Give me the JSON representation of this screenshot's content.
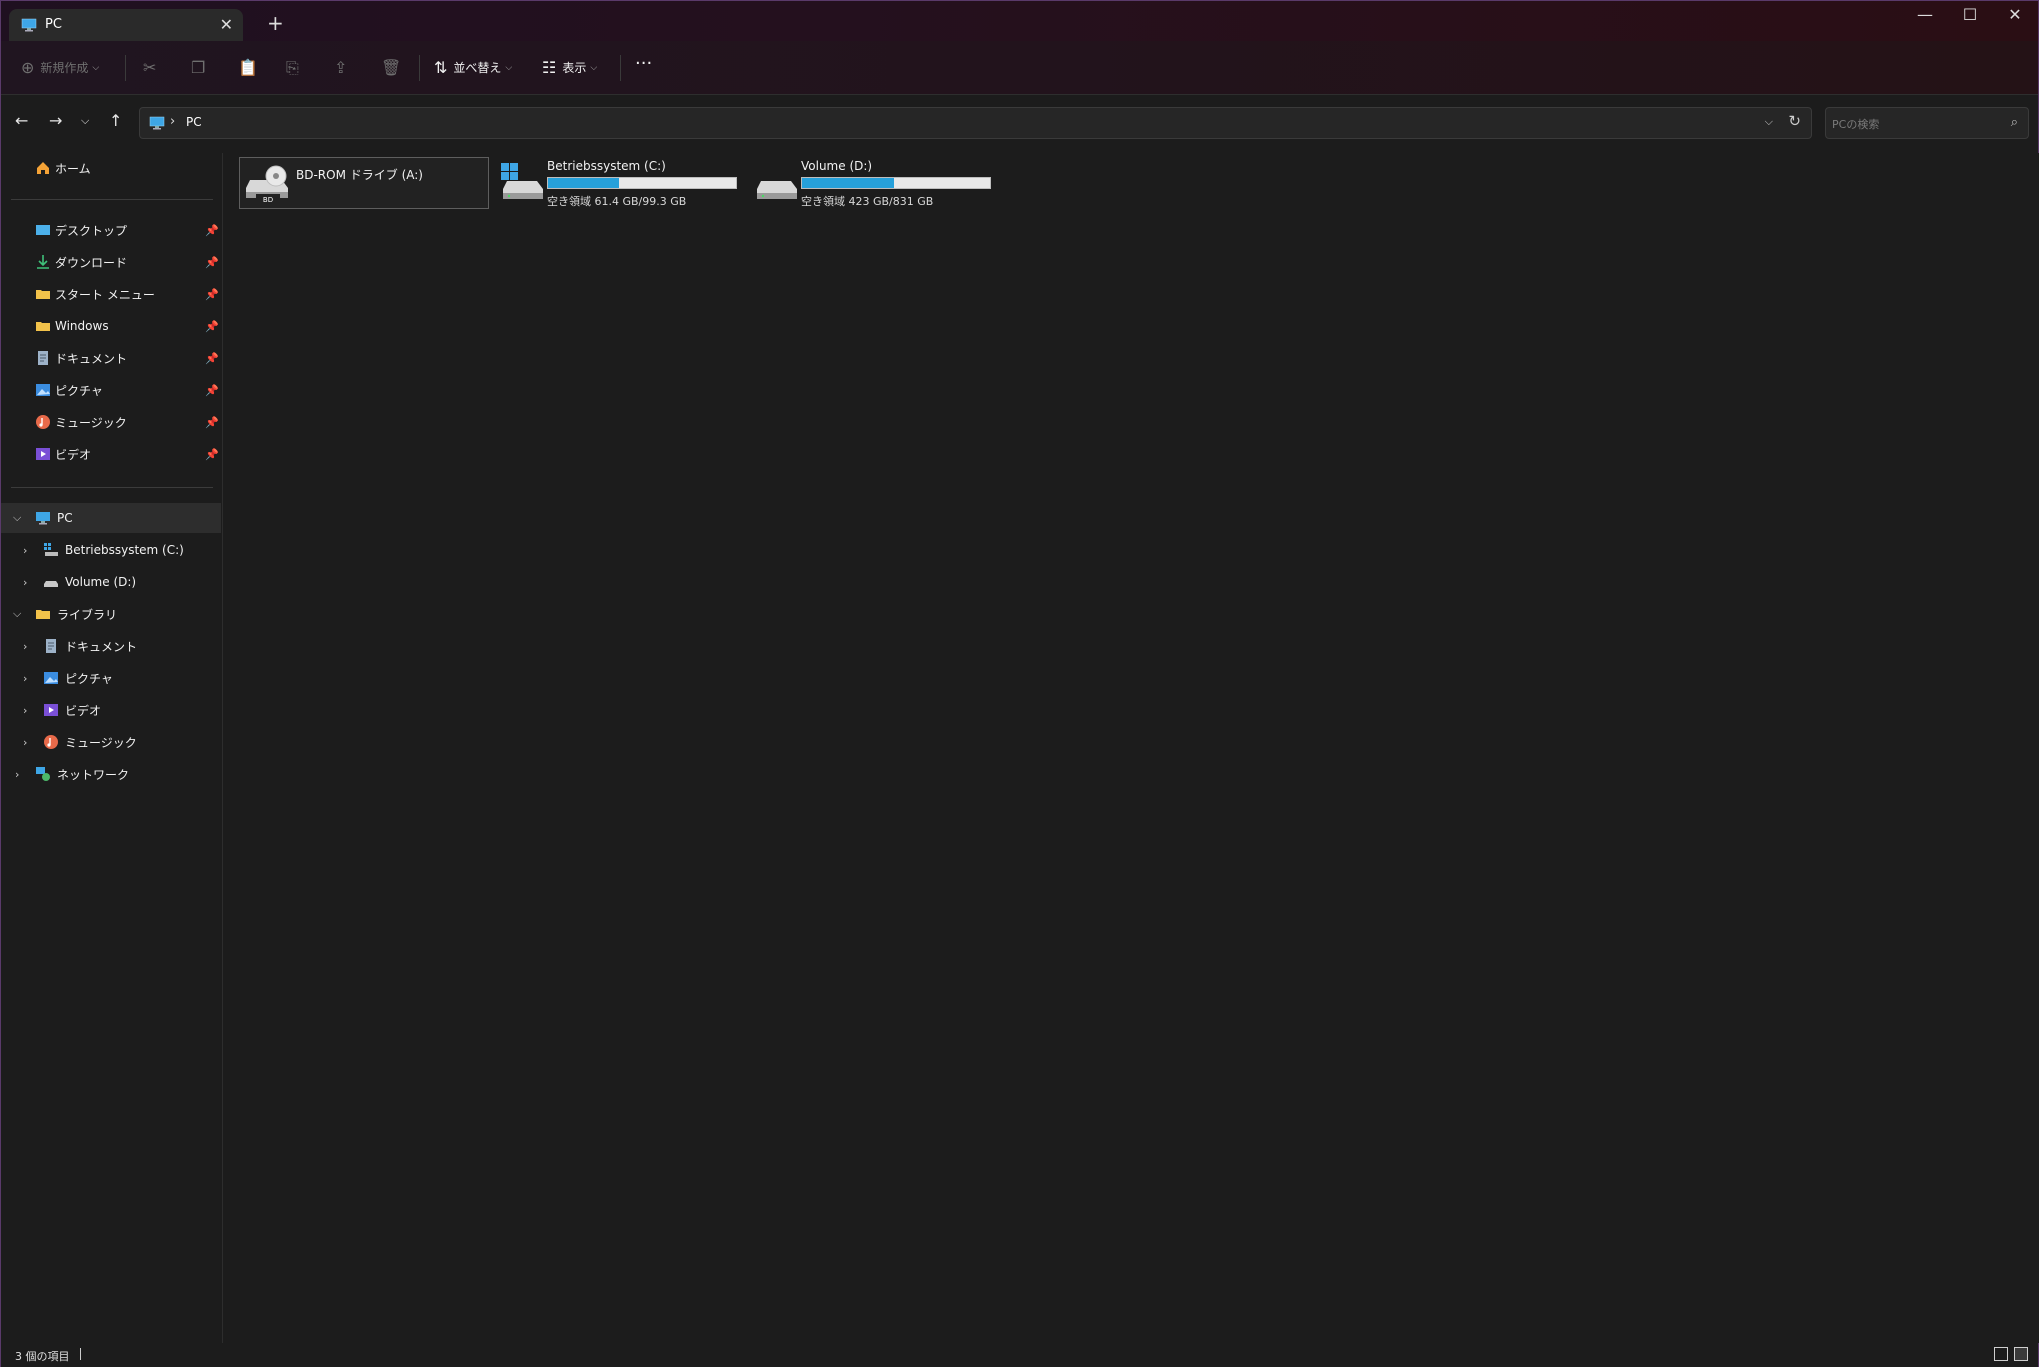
{
  "window": {
    "tab_title": "PC",
    "new_tab_symbol": "+",
    "tab_close_symbol": "✕",
    "minimize_symbol": "—",
    "maximize_symbol": "☐",
    "close_symbol": "✕"
  },
  "toolbar": {
    "new_label": "新規作成",
    "sort_label": "並べ替え",
    "view_label": "表示",
    "more_symbol": "···"
  },
  "address": {
    "path": "PC",
    "search_placeholder": "PCの検索"
  },
  "sidebar": {
    "home": "ホーム",
    "quick_access": [
      {
        "label": "デスクトップ",
        "icon": "desktop-icon"
      },
      {
        "label": "ダウンロード",
        "icon": "download-icon"
      },
      {
        "label": "スタート メニュー",
        "icon": "folder-icon"
      },
      {
        "label": "Windows",
        "icon": "folder-icon"
      },
      {
        "label": "ドキュメント",
        "icon": "document-icon"
      },
      {
        "label": "ピクチャ",
        "icon": "pictures-icon"
      },
      {
        "label": "ミュージック",
        "icon": "music-icon"
      },
      {
        "label": "ビデオ",
        "icon": "video-icon"
      }
    ],
    "tree": {
      "pc": "PC",
      "drive_c": "Betriebssystem (C:)",
      "drive_d": "Volume (D:)",
      "library": "ライブラリ",
      "lib_documents": "ドキュメント",
      "lib_pictures": "ピクチャ",
      "lib_videos": "ビデオ",
      "lib_music": "ミュージック",
      "network": "ネットワーク"
    }
  },
  "drives": [
    {
      "name": "BD-ROM ドライブ (A:)",
      "disc_label": "BD"
    },
    {
      "name": "Betriebssystem (C:)",
      "free_text": "空き領域 61.4 GB/99.3 GB",
      "used_fraction": 0.38
    },
    {
      "name": "Volume (D:)",
      "free_text": "空き領域 423 GB/831 GB",
      "used_fraction": 0.49
    }
  ],
  "status": {
    "item_count": "3 個の項目"
  },
  "colors": {
    "accent": "#26a0da",
    "background": "#1c1c1c"
  }
}
